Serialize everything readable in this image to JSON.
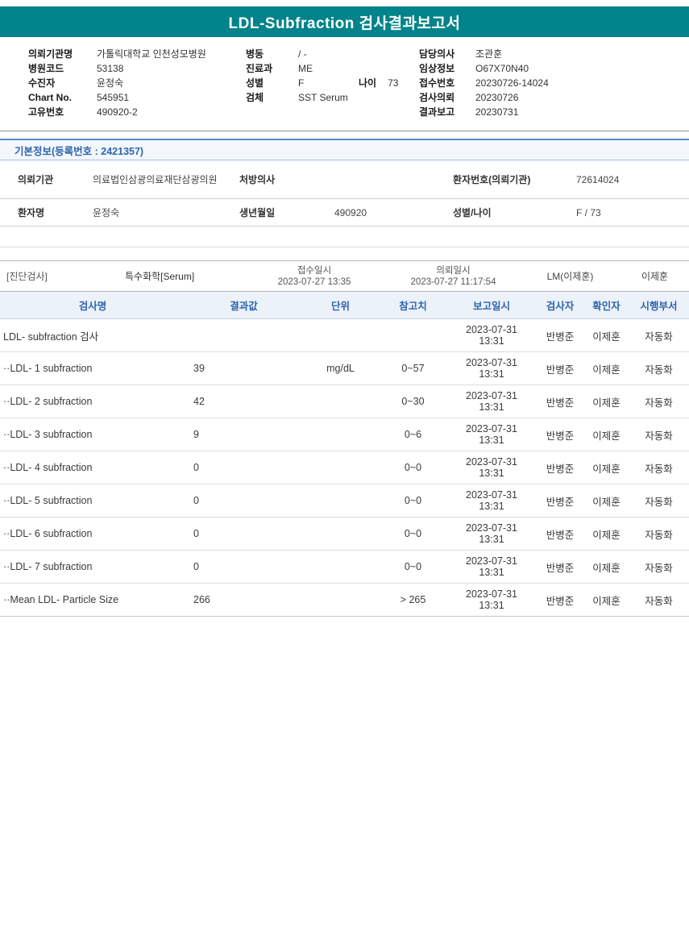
{
  "theme": {
    "banner_color": "#00838A",
    "accent_blue": "#2E64AD",
    "table_header_bg": "#ECF2F9"
  },
  "report": {
    "title": "LDL-Subfraction 검사결과보고서"
  },
  "header": {
    "left": [
      {
        "label": "의뢰기관명",
        "value": "가톨릭대학교 인천성모병원"
      },
      {
        "label": "병원코드",
        "value": "53138"
      },
      {
        "label": "수진자",
        "value": "윤정숙"
      },
      {
        "label": "Chart No.",
        "value": "545951"
      },
      {
        "label": "고유번호",
        "value": "490920-2"
      }
    ],
    "middle": [
      {
        "label": "병동",
        "value": "/ -"
      },
      {
        "label": "진료과",
        "value": "ME"
      },
      {
        "label": "성별",
        "value": "F",
        "extra_label": "나이",
        "extra_value": "73"
      },
      {
        "label": "검체",
        "value": "SST Serum"
      }
    ],
    "right": [
      {
        "label": "담당의사",
        "value": "조관훈"
      },
      {
        "label": "임상정보",
        "value": "O67X70N40"
      },
      {
        "label": "접수번호",
        "value": "20230726-14024"
      },
      {
        "label": "검사의뢰",
        "value": "20230726"
      },
      {
        "label": "결과보고",
        "value": "20230731"
      }
    ]
  },
  "basic_info": {
    "section_title": "기본정보(등록번호 : 2421357)",
    "rows": [
      {
        "l1": "의뢰기관",
        "v1": "의료법인삼광의료재단삼광의원",
        "l2": "처방의사",
        "v2": "",
        "l3": "환자번호(의뢰기관)",
        "v3": "72614024"
      },
      {
        "l1": "환자명",
        "v1": "윤정숙",
        "l2": "생년월일",
        "v2": "490920",
        "l3": "성별/나이",
        "v3": "F / 73"
      }
    ]
  },
  "test_meta": {
    "category": "[진단검사]",
    "test_group": "특수화학[Serum]",
    "receipt_label": "접수일시",
    "receipt_datetime": "2023-07-27 13:35",
    "request_label": "의뢰일시",
    "request_datetime": "2023-07-27 11:17:54",
    "lm": "LM(이제훈)",
    "confirmer": "이제훈"
  },
  "results": {
    "columns": [
      "검사명",
      "결과값",
      "단위",
      "참고치",
      "보고일시",
      "검사자",
      "확인자",
      "시행부서"
    ],
    "rows": [
      {
        "name": "LDL- subfraction 검사",
        "result": "",
        "unit": "",
        "ref": "",
        "report_date": "2023-07-31",
        "report_time": "13:31",
        "tester": "반병준",
        "verifier": "이제훈",
        "dept": "자동화"
      },
      {
        "name": "··LDL- 1 subfraction",
        "result": "39",
        "unit": "mg/dL",
        "ref": "0~57",
        "report_date": "2023-07-31",
        "report_time": "13:31",
        "tester": "반병준",
        "verifier": "이제훈",
        "dept": "자동화"
      },
      {
        "name": "··LDL- 2 subfraction",
        "result": "42",
        "unit": "",
        "ref": "0~30",
        "report_date": "2023-07-31",
        "report_time": "13:31",
        "tester": "반병준",
        "verifier": "이제훈",
        "dept": "자동화"
      },
      {
        "name": "··LDL- 3 subfraction",
        "result": "9",
        "unit": "",
        "ref": "0~6",
        "report_date": "2023-07-31",
        "report_time": "13:31",
        "tester": "반병준",
        "verifier": "이제훈",
        "dept": "자동화"
      },
      {
        "name": "··LDL- 4 subfraction",
        "result": "0",
        "unit": "",
        "ref": "0~0",
        "report_date": "2023-07-31",
        "report_time": "13:31",
        "tester": "반병준",
        "verifier": "이제훈",
        "dept": "자동화"
      },
      {
        "name": "··LDL- 5 subfraction",
        "result": "0",
        "unit": "",
        "ref": "0~0",
        "report_date": "2023-07-31",
        "report_time": "13:31",
        "tester": "반병준",
        "verifier": "이제훈",
        "dept": "자동화"
      },
      {
        "name": "··LDL- 6 subfraction",
        "result": "0",
        "unit": "",
        "ref": "0~0",
        "report_date": "2023-07-31",
        "report_time": "13:31",
        "tester": "반병준",
        "verifier": "이제훈",
        "dept": "자동화"
      },
      {
        "name": "··LDL- 7 subfraction",
        "result": "0",
        "unit": "",
        "ref": "0~0",
        "report_date": "2023-07-31",
        "report_time": "13:31",
        "tester": "반병준",
        "verifier": "이제훈",
        "dept": "자동화"
      },
      {
        "name": "··Mean LDL- Particle Size",
        "result": "266",
        "unit": "",
        "ref": "> 265",
        "report_date": "2023-07-31",
        "report_time": "13:31",
        "tester": "반병준",
        "verifier": "이제훈",
        "dept": "자동화"
      }
    ]
  }
}
